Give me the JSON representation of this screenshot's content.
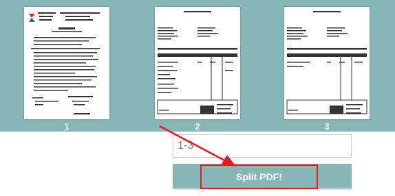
{
  "thumbnails": [
    {
      "label": "1"
    },
    {
      "label": "2"
    },
    {
      "label": "3"
    }
  ],
  "range_input": {
    "value": "1-3"
  },
  "split_button": {
    "label": "Split PDF!"
  },
  "colors": {
    "strip": "#86b6b6",
    "highlight": "#e8161f"
  },
  "icons": [
    "logo-icon",
    "arrow-annotation-icon"
  ]
}
